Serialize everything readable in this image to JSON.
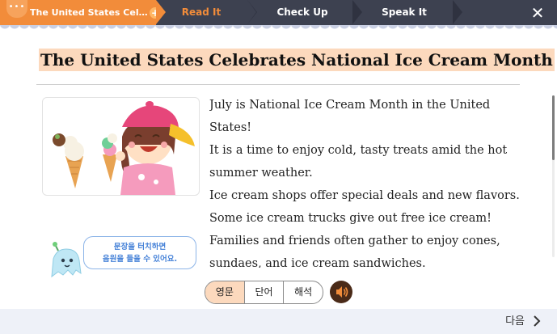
{
  "header": {
    "handle_glyph": "•••",
    "active_step_label": "The United States Celebrate…",
    "plus_glyph": "+",
    "steps": [
      {
        "label": "Read It",
        "color": "#f28c3a"
      },
      {
        "label": "Check Up",
        "color": "#ffffff"
      },
      {
        "label": "Speak It",
        "color": "#ffffff"
      }
    ],
    "close_glyph": "✕",
    "bar_color": "#3d4150",
    "active_color": "#f28c3a"
  },
  "article": {
    "title": "The United States Celebrates National Ice Cream Month",
    "lines": [
      "July is National Ice Cream Month in the United",
      "States!",
      "It is a time to enjoy cold, tasty treats amid the hot",
      "summer weather.",
      "Ice cream shops offer special deals and new flavors.",
      "Some ice cream trucks give out free ice cream!",
      "Families and friends often gather to enjoy cones,",
      "sundaes, and ice cream sandwiches."
    ],
    "illustration_icon": "girl-eating-ice-cream-illustration"
  },
  "hint": {
    "line1": "문장을 터치하면",
    "line2": "음원을 들을 수 있어요.",
    "mascot_icon": "ghost-mascot-icon"
  },
  "mode_toggle": {
    "options": [
      "영문",
      "단어",
      "해석"
    ],
    "selected": "영문"
  },
  "audio": {
    "icon": "speaker-icon"
  },
  "footer": {
    "next_label": "다음",
    "next_icon": "chevron-right-icon"
  }
}
